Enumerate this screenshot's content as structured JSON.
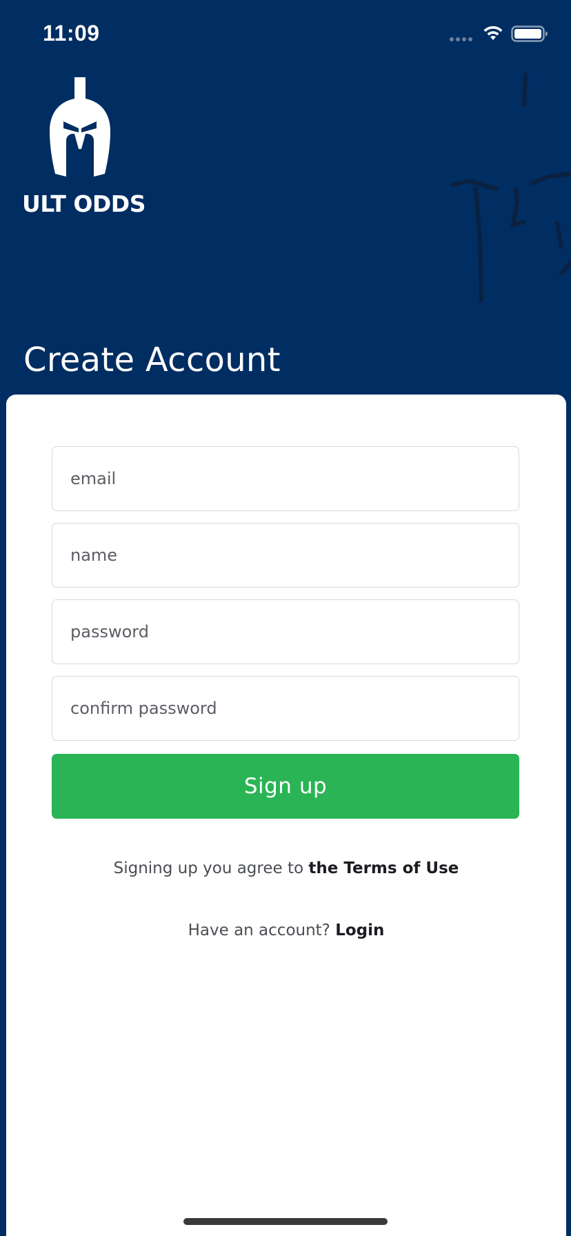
{
  "status_bar": {
    "time": "11:09",
    "wifi_icon": "wifi-icon",
    "battery_icon": "battery-icon",
    "signal_icon": "cellular-signal-icon"
  },
  "brand": {
    "logo_icon": "spartan-helmet-icon",
    "name": "ULT ODDS"
  },
  "page": {
    "title": "Create Account"
  },
  "form": {
    "email_placeholder": "email",
    "email_value": "",
    "name_placeholder": "name",
    "name_value": "",
    "password_placeholder": "password",
    "password_value": "",
    "confirm_password_placeholder": "confirm password",
    "confirm_password_value": "",
    "submit_label": "Sign up"
  },
  "footer": {
    "terms_prefix": "Signing up you agree to ",
    "terms_link": "the Terms of Use",
    "login_prefix": "Have an account? ",
    "login_link": "Login"
  },
  "colors": {
    "background": "#002d62",
    "card": "#ffffff",
    "primary_button": "#2bb455",
    "field_border": "#d6d8dc",
    "text_muted": "#4a4d52",
    "text_strong": "#1b1d21"
  }
}
